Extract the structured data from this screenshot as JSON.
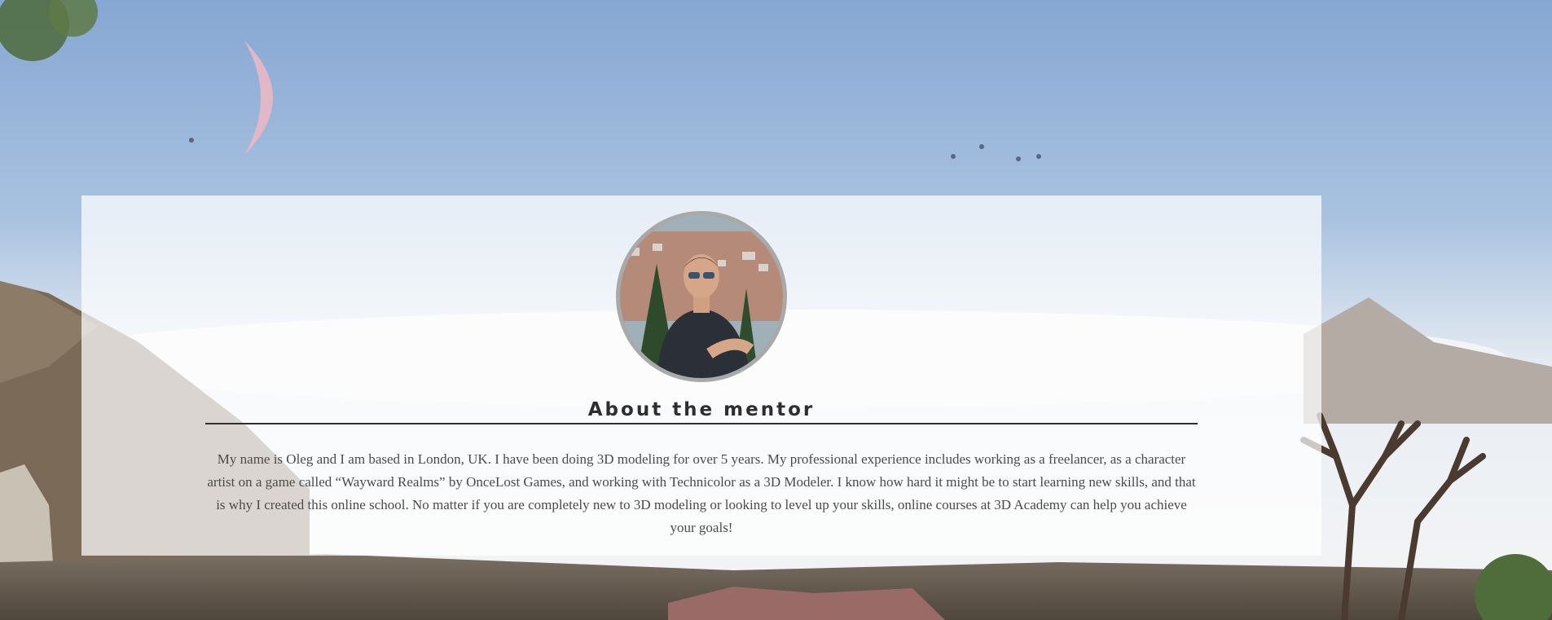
{
  "mentor_section": {
    "heading": "About the mentor",
    "bio": "My name is Oleg and I am based in London, UK. I have been doing 3D modeling for over 5 years. My professional experience includes working as a freelancer, as a character artist on a game called “Wayward Realms” by OnceLost Games, and working with Technicolor as a 3D Modeler. I know how hard it might be to start learning new skills, and that is why I created this online school. No matter if you are completely new to 3D modeling or looking to level up your skills, online courses at 3D Academy can help you achieve your goals!"
  },
  "colors": {
    "sky_top": "#8fb0d8",
    "sky_horizon": "#dfe7f0",
    "card_bg": "#ffffff",
    "heading_text": "#2e2e2e",
    "body_text": "#4b4b4b",
    "avatar_ring": "#a9a9a9"
  },
  "icons": {
    "background": "fantasy-landscape-illustration",
    "avatar": "mentor-portrait-photo"
  }
}
